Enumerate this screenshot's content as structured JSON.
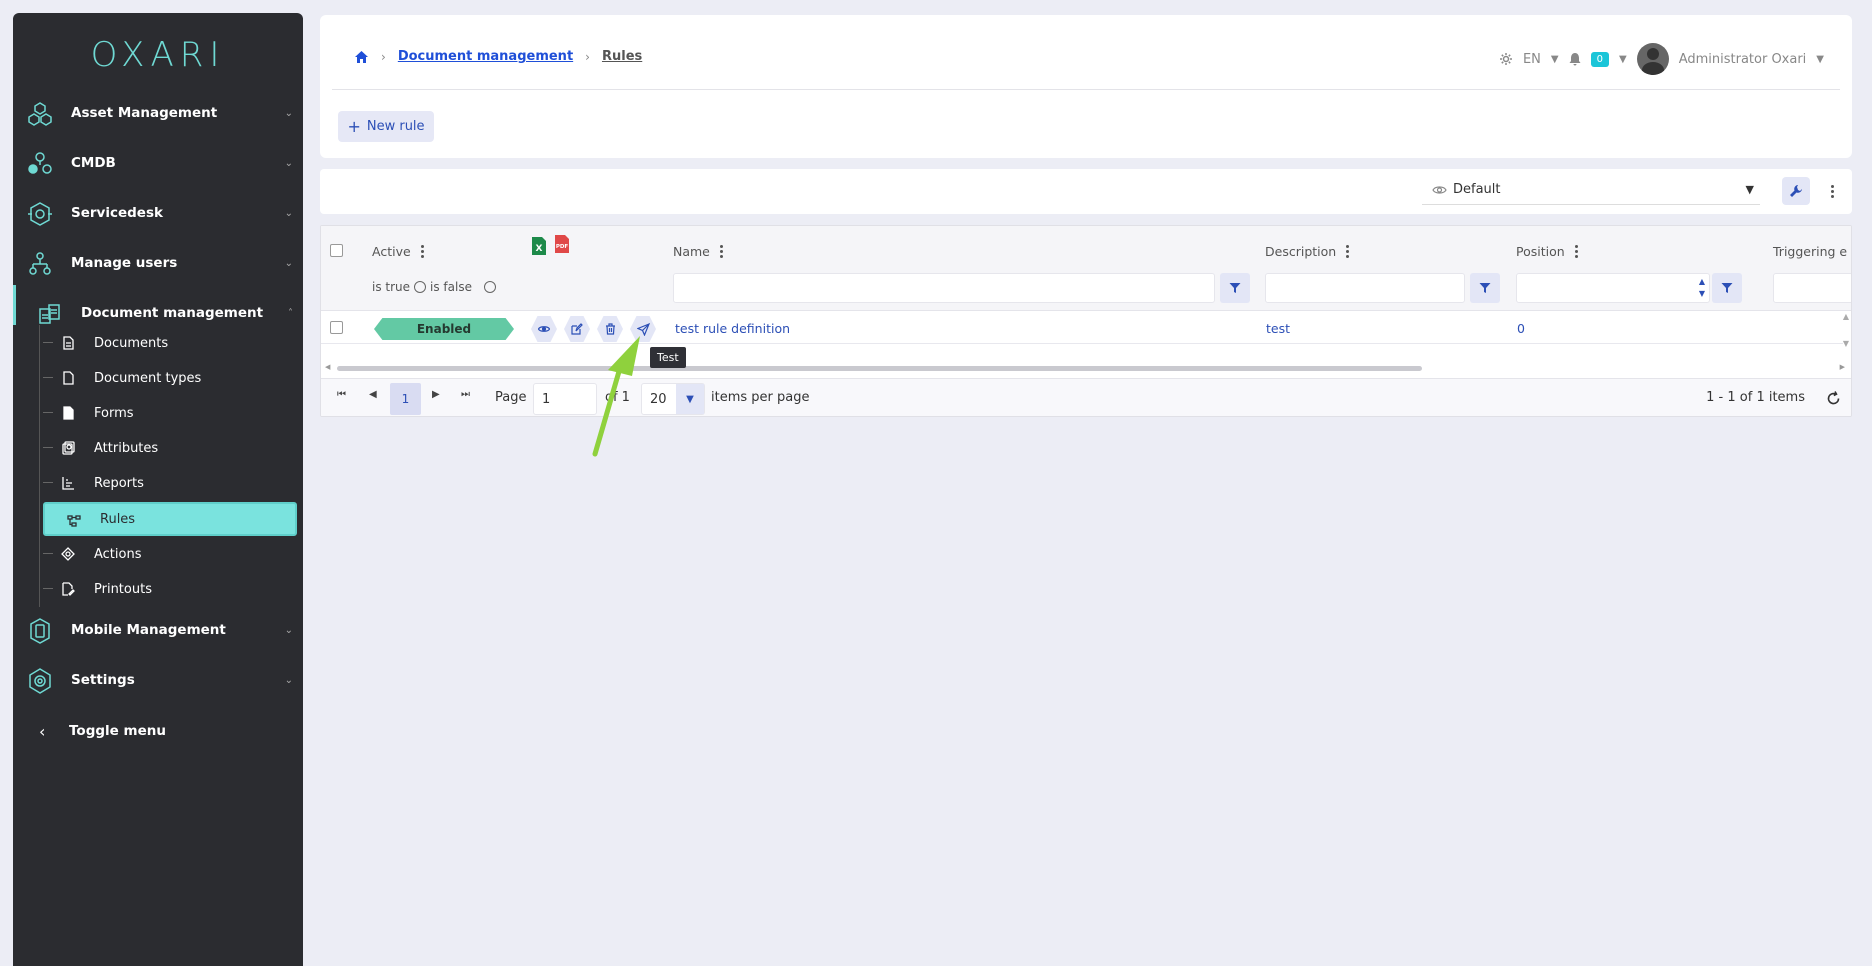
{
  "sidebar": {
    "logo": "OXARI",
    "items": [
      {
        "label": "Asset Management",
        "icon": "hexagon-cluster-icon"
      },
      {
        "label": "CMDB",
        "icon": "cmdb-icon"
      },
      {
        "label": "Servicedesk",
        "icon": "servicedesk-icon"
      },
      {
        "label": "Manage users",
        "icon": "users-tree-icon"
      },
      {
        "label": "Document management",
        "icon": "documents-icon"
      },
      {
        "label": "Mobile Management",
        "icon": "mobile-icon"
      },
      {
        "label": "Settings",
        "icon": "settings-gear-icon"
      }
    ],
    "sub_items": [
      {
        "label": "Documents"
      },
      {
        "label": "Document types"
      },
      {
        "label": "Forms"
      },
      {
        "label": "Attributes"
      },
      {
        "label": "Reports"
      },
      {
        "label": "Rules"
      },
      {
        "label": "Actions"
      },
      {
        "label": "Printouts"
      }
    ],
    "toggle_menu": "Toggle menu"
  },
  "breadcrumb": {
    "parent": "Document management",
    "current": "Rules"
  },
  "header": {
    "language": "EN",
    "notifications": "0",
    "user": "Administrator Oxari"
  },
  "toolbar": {
    "new_rule": "New rule",
    "view": "Default"
  },
  "grid": {
    "columns": {
      "active": "Active",
      "name": "Name",
      "description": "Description",
      "position": "Position",
      "triggering": "Triggering e"
    },
    "active_filter": {
      "is_true": "is true",
      "is_false": "is false"
    },
    "rows": [
      {
        "status": "Enabled",
        "name": "test rule definition",
        "description": "test",
        "position": "0"
      }
    ]
  },
  "pager": {
    "current_page": "1",
    "page_label": "Page",
    "page_value": "1",
    "of_label": "of 1",
    "page_size": "20",
    "items_per_page": "items per page",
    "summary": "1 - 1 of 1 items"
  },
  "tooltip": "Test",
  "colors": {
    "accent": "#6fd9d3",
    "link": "#2c4fb6",
    "enabled": "#63c9a4",
    "sidebar": "#2b2c30"
  }
}
